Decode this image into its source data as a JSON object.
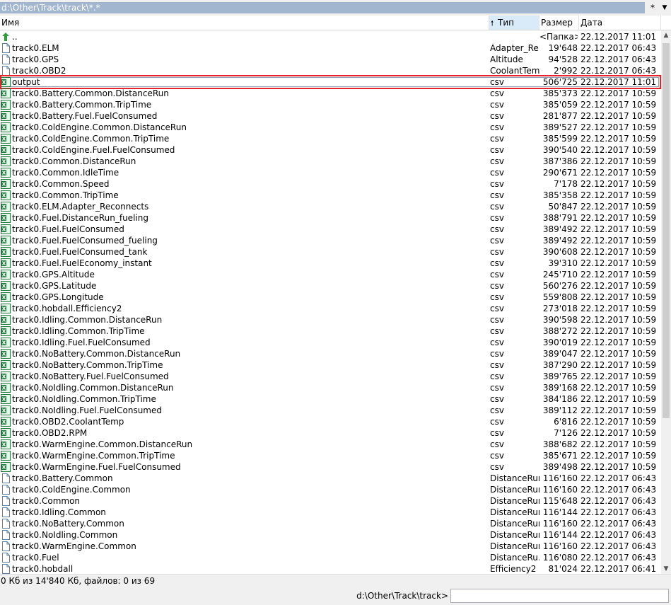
{
  "path_bar": {
    "path": "d:\\Other\\Track\\track\\*.*",
    "star": "*",
    "dropdown": "▼"
  },
  "columns": {
    "name": "Имя",
    "type": "Тип",
    "size": "Размер",
    "date": "Дата",
    "sort_arrow": "🠕"
  },
  "colors": {
    "selection_outline": "#e5242b",
    "path_bar": "#a3b6cf",
    "sorted_header": "#d9ebf9"
  },
  "rows": [
    {
      "icon": "up-arrow-icon",
      "name": "..",
      "type": "",
      "size": "<Папка>",
      "date": "22.12.2017 11:01"
    },
    {
      "icon": "file-icon",
      "name": "track0.ELM",
      "type": "Adapter_Re…",
      "size": "19'648",
      "date": "22.12.2017 06:43"
    },
    {
      "icon": "file-icon",
      "name": "track0.GPS",
      "type": "Altitude",
      "size": "94'528",
      "date": "22.12.2017 06:43"
    },
    {
      "icon": "file-icon",
      "name": "track0.OBD2",
      "type": "CoolantTemp",
      "size": "2'992",
      "date": "22.12.2017 06:43"
    },
    {
      "icon": "csv-icon",
      "name": "output",
      "type": "csv",
      "size": "506'725",
      "date": "22.12.2017 11:01",
      "selected": true
    },
    {
      "icon": "csv-icon",
      "name": "track0.Battery.Common.DistanceRun",
      "type": "csv",
      "size": "385'373",
      "date": "22.12.2017 10:59"
    },
    {
      "icon": "csv-icon",
      "name": "track0.Battery.Common.TripTime",
      "type": "csv",
      "size": "385'059",
      "date": "22.12.2017 10:59"
    },
    {
      "icon": "csv-icon",
      "name": "track0.Battery.Fuel.FuelConsumed",
      "type": "csv",
      "size": "281'877",
      "date": "22.12.2017 10:59"
    },
    {
      "icon": "csv-icon",
      "name": "track0.ColdEngine.Common.DistanceRun",
      "type": "csv",
      "size": "389'527",
      "date": "22.12.2017 10:59"
    },
    {
      "icon": "csv-icon",
      "name": "track0.ColdEngine.Common.TripTime",
      "type": "csv",
      "size": "385'599",
      "date": "22.12.2017 10:59"
    },
    {
      "icon": "csv-icon",
      "name": "track0.ColdEngine.Fuel.FuelConsumed",
      "type": "csv",
      "size": "390'540",
      "date": "22.12.2017 10:59"
    },
    {
      "icon": "csv-icon",
      "name": "track0.Common.DistanceRun",
      "type": "csv",
      "size": "387'386",
      "date": "22.12.2017 10:59"
    },
    {
      "icon": "csv-icon",
      "name": "track0.Common.IdleTime",
      "type": "csv",
      "size": "290'671",
      "date": "22.12.2017 10:59"
    },
    {
      "icon": "csv-icon",
      "name": "track0.Common.Speed",
      "type": "csv",
      "size": "7'178",
      "date": "22.12.2017 10:59"
    },
    {
      "icon": "csv-icon",
      "name": "track0.Common.TripTime",
      "type": "csv",
      "size": "385'358",
      "date": "22.12.2017 10:59"
    },
    {
      "icon": "csv-icon",
      "name": "track0.ELM.Adapter_Reconnects",
      "type": "csv",
      "size": "50'847",
      "date": "22.12.2017 10:59"
    },
    {
      "icon": "csv-icon",
      "name": "track0.Fuel.DistanceRun_fueling",
      "type": "csv",
      "size": "388'791",
      "date": "22.12.2017 10:59"
    },
    {
      "icon": "csv-icon",
      "name": "track0.Fuel.FuelConsumed",
      "type": "csv",
      "size": "389'492",
      "date": "22.12.2017 10:59"
    },
    {
      "icon": "csv-icon",
      "name": "track0.Fuel.FuelConsumed_fueling",
      "type": "csv",
      "size": "389'492",
      "date": "22.12.2017 10:59"
    },
    {
      "icon": "csv-icon",
      "name": "track0.Fuel.FuelConsumed_tank",
      "type": "csv",
      "size": "390'608",
      "date": "22.12.2017 10:59"
    },
    {
      "icon": "csv-icon",
      "name": "track0.Fuel.FuelEconomy_instant",
      "type": "csv",
      "size": "39'310",
      "date": "22.12.2017 10:59"
    },
    {
      "icon": "csv-icon",
      "name": "track0.GPS.Altitude",
      "type": "csv",
      "size": "245'710",
      "date": "22.12.2017 10:59"
    },
    {
      "icon": "csv-icon",
      "name": "track0.GPS.Latitude",
      "type": "csv",
      "size": "560'276",
      "date": "22.12.2017 10:59"
    },
    {
      "icon": "csv-icon",
      "name": "track0.GPS.Longitude",
      "type": "csv",
      "size": "559'808",
      "date": "22.12.2017 10:59"
    },
    {
      "icon": "csv-icon",
      "name": "track0.hobdall.Efficiency2",
      "type": "csv",
      "size": "273'018",
      "date": "22.12.2017 10:59"
    },
    {
      "icon": "csv-icon",
      "name": "track0.Idling.Common.DistanceRun",
      "type": "csv",
      "size": "390'598",
      "date": "22.12.2017 10:59"
    },
    {
      "icon": "csv-icon",
      "name": "track0.Idling.Common.TripTime",
      "type": "csv",
      "size": "388'272",
      "date": "22.12.2017 10:59"
    },
    {
      "icon": "csv-icon",
      "name": "track0.Idling.Fuel.FuelConsumed",
      "type": "csv",
      "size": "390'019",
      "date": "22.12.2017 10:59"
    },
    {
      "icon": "csv-icon",
      "name": "track0.NoBattery.Common.DistanceRun",
      "type": "csv",
      "size": "389'047",
      "date": "22.12.2017 10:59"
    },
    {
      "icon": "csv-icon",
      "name": "track0.NoBattery.Common.TripTime",
      "type": "csv",
      "size": "387'290",
      "date": "22.12.2017 10:59"
    },
    {
      "icon": "csv-icon",
      "name": "track0.NoBattery.Fuel.FuelConsumed",
      "type": "csv",
      "size": "389'765",
      "date": "22.12.2017 10:59"
    },
    {
      "icon": "csv-icon",
      "name": "track0.NoIdling.Common.DistanceRun",
      "type": "csv",
      "size": "389'168",
      "date": "22.12.2017 10:59"
    },
    {
      "icon": "csv-icon",
      "name": "track0.NoIdling.Common.TripTime",
      "type": "csv",
      "size": "384'186",
      "date": "22.12.2017 10:59"
    },
    {
      "icon": "csv-icon",
      "name": "track0.NoIdling.Fuel.FuelConsumed",
      "type": "csv",
      "size": "389'112",
      "date": "22.12.2017 10:59"
    },
    {
      "icon": "csv-icon",
      "name": "track0.OBD2.CoolantTemp",
      "type": "csv",
      "size": "6'816",
      "date": "22.12.2017 10:59"
    },
    {
      "icon": "csv-icon",
      "name": "track0.OBD2.RPM",
      "type": "csv",
      "size": "7'126",
      "date": "22.12.2017 10:59"
    },
    {
      "icon": "csv-icon",
      "name": "track0.WarmEngine.Common.DistanceRun",
      "type": "csv",
      "size": "388'682",
      "date": "22.12.2017 10:59"
    },
    {
      "icon": "csv-icon",
      "name": "track0.WarmEngine.Common.TripTime",
      "type": "csv",
      "size": "385'671",
      "date": "22.12.2017 10:59"
    },
    {
      "icon": "csv-icon",
      "name": "track0.WarmEngine.Fuel.FuelConsumed",
      "type": "csv",
      "size": "389'498",
      "date": "22.12.2017 10:59"
    },
    {
      "icon": "file-icon",
      "name": "track0.Battery.Common",
      "type": "DistanceRun",
      "size": "116'160",
      "date": "22.12.2017 06:43"
    },
    {
      "icon": "file-icon",
      "name": "track0.ColdEngine.Common",
      "type": "DistanceRun",
      "size": "116'160",
      "date": "22.12.2017 06:43"
    },
    {
      "icon": "file-icon",
      "name": "track0.Common",
      "type": "DistanceRun",
      "size": "115'648",
      "date": "22.12.2017 06:43"
    },
    {
      "icon": "file-icon",
      "name": "track0.Idling.Common",
      "type": "DistanceRun",
      "size": "116'144",
      "date": "22.12.2017 06:43"
    },
    {
      "icon": "file-icon",
      "name": "track0.NoBattery.Common",
      "type": "DistanceRun",
      "size": "116'160",
      "date": "22.12.2017 06:43"
    },
    {
      "icon": "file-icon",
      "name": "track0.NoIdling.Common",
      "type": "DistanceRun",
      "size": "116'144",
      "date": "22.12.2017 06:43"
    },
    {
      "icon": "file-icon",
      "name": "track0.WarmEngine.Common",
      "type": "DistanceRun",
      "size": "116'160",
      "date": "22.12.2017 06:43"
    },
    {
      "icon": "file-icon",
      "name": "track0.Fuel",
      "type": "DistanceRu…",
      "size": "116'080",
      "date": "22.12.2017 06:43"
    },
    {
      "icon": "file-icon",
      "name": "track0.hobdall",
      "type": "Efficiency2",
      "size": "81'024",
      "date": "22.12.2017 06:41"
    }
  ],
  "status": "0 Кб из 14'840 Кб, файлов: 0 из 69",
  "command_line": {
    "prompt": "d:\\Other\\Track\\track>",
    "value": ""
  }
}
